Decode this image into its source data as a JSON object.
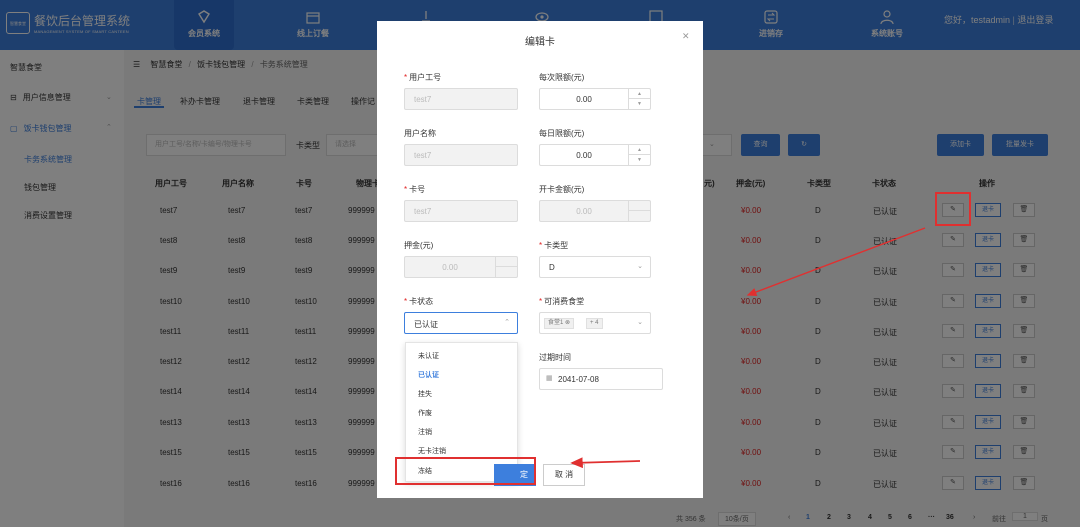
{
  "header": {
    "brand": "餐饮后台管理系统",
    "brand_sub": "MANAGEMENT SYSTEM OF SMART CANTEEN",
    "logo_text": "智慧食堂",
    "nav": [
      {
        "label": "会员系统",
        "icon": "diamond-icon",
        "active": true
      },
      {
        "label": "线上订餐",
        "icon": "shop-icon"
      },
      {
        "label": "",
        "icon": "flag-icon"
      },
      {
        "label": "",
        "icon": "eye-icon"
      },
      {
        "label": "",
        "icon": "image-icon"
      },
      {
        "label": "进销存",
        "icon": "exchange-icon"
      },
      {
        "label": "系统账号",
        "icon": "users-icon"
      }
    ],
    "user_greeting": "您好，testadmin",
    "logout": "退出登录"
  },
  "sidebar": {
    "title": "智慧食堂",
    "menus": [
      {
        "label": "用户信息管理",
        "icon": "user-icon"
      },
      {
        "label": "饭卡钱包管理",
        "icon": "card-icon"
      }
    ],
    "subitems": [
      "卡务系统管理",
      "钱包管理",
      "消费设置管理"
    ]
  },
  "breadcrumb": [
    "智慧食堂",
    "饭卡钱包管理",
    "卡务系统管理"
  ],
  "tabs": [
    "卡管理",
    "补办卡管理",
    "退卡管理",
    "卡类管理",
    "操作记"
  ],
  "filters": {
    "search_placeholder": "用户工号/名称/卡编号/物理卡号",
    "card_type_label": "卡类型",
    "card_type_placeholder": "请选择",
    "query": "查询",
    "add": "添加卡",
    "batch": "批量发卡"
  },
  "table": {
    "headers": [
      "用户工号",
      "用户名称",
      "卡号",
      "物理卡",
      "元)",
      "押金(元)",
      "卡类型",
      "卡状态",
      "操作"
    ],
    "rows": [
      {
        "id": "test7",
        "name": "test7",
        "card": "test7",
        "phys": "999999",
        "deposit": "¥0.00",
        "type": "D",
        "status": "已认证"
      },
      {
        "id": "test8",
        "name": "test8",
        "card": "test8",
        "phys": "999999",
        "deposit": "¥0.00",
        "type": "D",
        "status": "已认证"
      },
      {
        "id": "test9",
        "name": "test9",
        "card": "test9",
        "phys": "999999",
        "deposit": "¥0.00",
        "type": "D",
        "status": "已认证"
      },
      {
        "id": "test10",
        "name": "test10",
        "card": "test10",
        "phys": "999999",
        "deposit": "¥0.00",
        "type": "D",
        "status": "已认证"
      },
      {
        "id": "test11",
        "name": "test11",
        "card": "test11",
        "phys": "999999",
        "deposit": "¥0.00",
        "type": "D",
        "status": "已认证"
      },
      {
        "id": "test12",
        "name": "test12",
        "card": "test12",
        "phys": "999999",
        "deposit": "¥0.00",
        "type": "D",
        "status": "已认证"
      },
      {
        "id": "test14",
        "name": "test14",
        "card": "test14",
        "phys": "999999",
        "deposit": "¥0.00",
        "type": "D",
        "status": "已认证"
      },
      {
        "id": "test13",
        "name": "test13",
        "card": "test13",
        "phys": "999999",
        "deposit": "¥0.00",
        "type": "D",
        "status": "已认证"
      },
      {
        "id": "test15",
        "name": "test15",
        "card": "test15",
        "phys": "999999",
        "deposit": "¥0.00",
        "type": "D",
        "status": "已认证"
      },
      {
        "id": "test16",
        "name": "test16",
        "card": "test16",
        "phys": "999999",
        "deposit": "¥0.00",
        "type": "D",
        "status": "已认证"
      }
    ],
    "op_return": "退卡"
  },
  "pagination": {
    "total": "共 356 条",
    "page_size": "10条/页",
    "pages": [
      "1",
      "2",
      "3",
      "4",
      "5",
      "6",
      "···",
      "36"
    ],
    "goto": "前往",
    "goto_value": "1",
    "page_suffix": "页"
  },
  "modal": {
    "title": "编辑卡",
    "fields": {
      "user_id": {
        "label": "用户工号",
        "value": "test7"
      },
      "limit_per": {
        "label": "每次限额(元)",
        "value": "0.00"
      },
      "user_name": {
        "label": "用户名称",
        "value": "test7"
      },
      "limit_day": {
        "label": "每日限额(元)",
        "value": "0.00"
      },
      "card_no": {
        "label": "卡号",
        "value": "test7"
      },
      "open_amount": {
        "label": "开卡金额(元)",
        "value": "0.00"
      },
      "deposit": {
        "label": "押金(元)",
        "value": "0.00"
      },
      "card_type": {
        "label": "卡类型",
        "value": "D"
      },
      "card_status": {
        "label": "卡状态",
        "value": "已认证"
      },
      "canteen": {
        "label": "可消费食堂",
        "tag": "食堂1",
        "more": "+ 4"
      },
      "expire": {
        "label": "过期时间",
        "value": "2041-07-08"
      }
    },
    "status_options": [
      "未认证",
      "已认证",
      "挂失",
      "作废",
      "注销",
      "无卡注销",
      "冻结"
    ],
    "selected_status": "已认证",
    "ok_label": "定",
    "cancel_label": "取 消"
  },
  "colors": {
    "primary": "#3d7fdd",
    "danger": "#e02020",
    "annotation": "#e03030"
  }
}
